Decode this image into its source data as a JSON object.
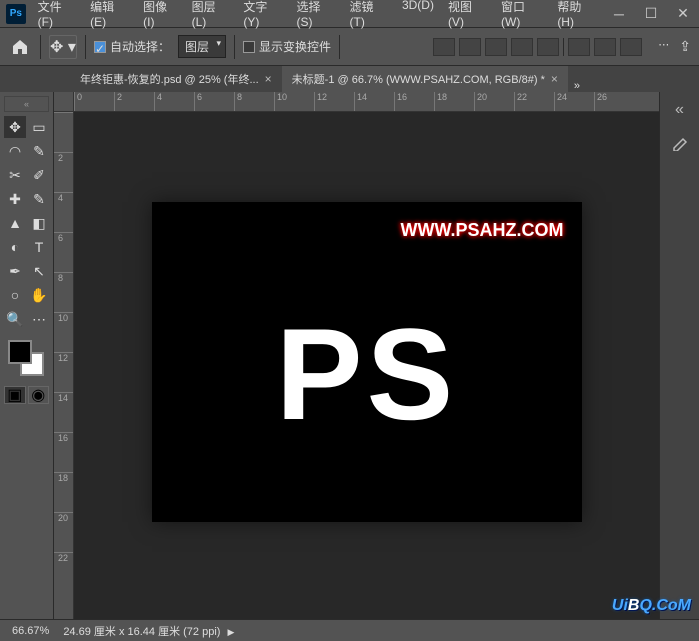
{
  "app": {
    "logo": "Ps"
  },
  "menu": {
    "file": "文件(F)",
    "edit": "编辑(E)",
    "image": "图像(I)",
    "layer": "图层(L)",
    "text": "文字(Y)",
    "select": "选择(S)",
    "filter": "滤镜(T)",
    "threeD": "3D(D)",
    "view": "视图(V)",
    "window": "窗口(W)",
    "help": "帮助(H)"
  },
  "options": {
    "autoSelect": "自动选择：",
    "dropdown": "图层",
    "showTransform": "显示变换控件"
  },
  "tabs": {
    "tab1": "年终钜惠-恢复的.psd @ 25% (年终...",
    "tab2": "未标题-1 @ 66.7% (WWW.PSAHZ.COM, RGB/8#) *"
  },
  "ruler_h": [
    "0",
    "2",
    "4",
    "6",
    "8",
    "10",
    "12",
    "14",
    "16",
    "18",
    "20",
    "22",
    "24",
    "26"
  ],
  "ruler_v": [
    "",
    "2",
    "4",
    "6",
    "8",
    "10",
    "12",
    "14",
    "16",
    "18",
    "20",
    "22"
  ],
  "canvas": {
    "watermark": "WWW.PSAHZ.COM",
    "main_text": "PS"
  },
  "status": {
    "zoom": "66.67%",
    "dimensions": "24.69 厘米 x 16.44 厘米 (72 ppi)"
  },
  "site_watermark": {
    "pre": "Ui",
    "b": "B",
    "post": "Q.CoM"
  }
}
